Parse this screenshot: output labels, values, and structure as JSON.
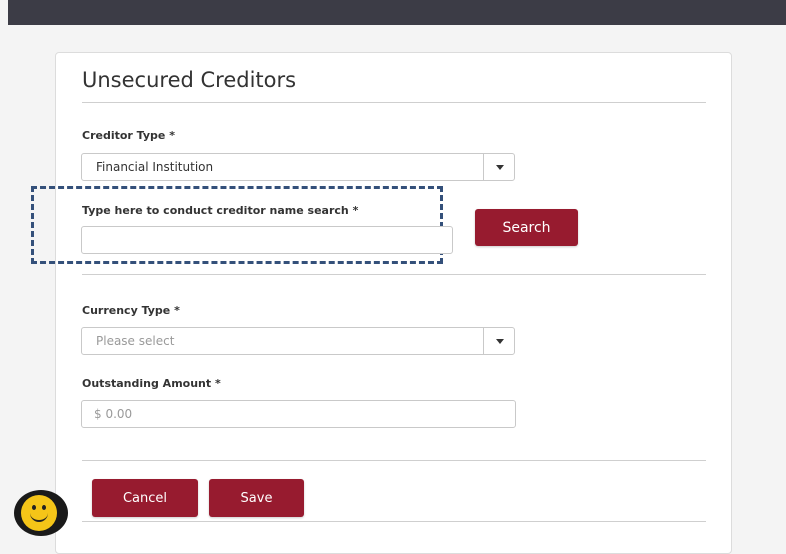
{
  "form": {
    "title": "Unsecured Creditors",
    "creditor_type": {
      "label": "Creditor Type *",
      "value": "Financial Institution"
    },
    "creditor_search": {
      "label": "Type here to conduct creditor name search *",
      "value": "",
      "button": "Search"
    },
    "currency_type": {
      "label": "Currency Type *",
      "placeholder": "Please select"
    },
    "outstanding_amount": {
      "label": "Outstanding Amount *",
      "placeholder": "$ 0.00"
    },
    "actions": {
      "cancel": "Cancel",
      "save": "Save"
    }
  },
  "assistant": {
    "icon": "smiley-face-icon"
  },
  "colors": {
    "primary_button": "#971b2f",
    "highlight_dash": "#34507a",
    "top_bar": "#3c3c46"
  }
}
